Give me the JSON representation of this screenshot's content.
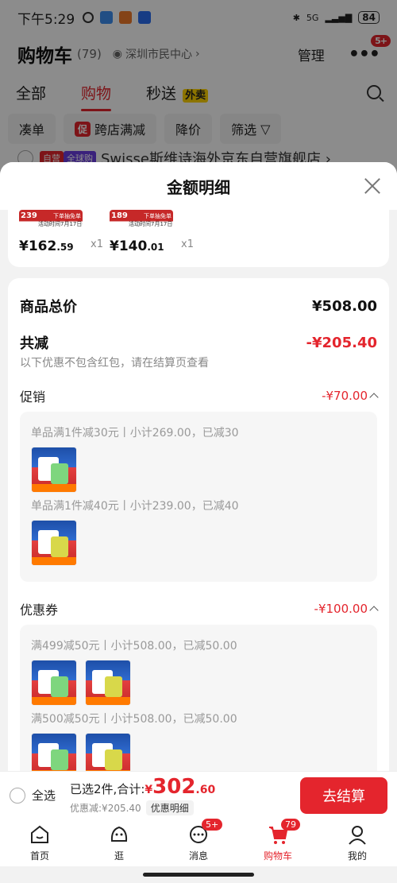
{
  "status": {
    "time": "下午5:29",
    "network": "5G",
    "battery": "84"
  },
  "header": {
    "title": "购物车",
    "count": "(79)",
    "location": "深圳市民中心",
    "manage": "管理",
    "more_badge": "5+"
  },
  "tabs": [
    {
      "label": "全部"
    },
    {
      "label": "购物"
    },
    {
      "label": "秒送"
    }
  ],
  "tab_flash_tag": "外卖",
  "chips": [
    {
      "label": "凑单"
    },
    {
      "label": "跨店满减"
    },
    {
      "label": "降价"
    },
    {
      "label": "筛选"
    }
  ],
  "chip_promo_tag": "促",
  "store": {
    "tag1": "自营",
    "tag2": "全球购",
    "name": "Swisse斯维诗海外京东自营旗舰店 ›"
  },
  "sheet": {
    "title": "金额明细",
    "products": [
      {
        "price_int": "¥162",
        "price_dec": ".59",
        "qty": "x1",
        "banner_price": "239",
        "banner_date": "活动时间7月17日-18日",
        "banner_tag": "下单抽免单"
      },
      {
        "price_int": "¥140",
        "price_dec": ".01",
        "qty": "x1",
        "banner_price": "189",
        "banner_date": "活动时间7月17日-18日",
        "banner_tag": "下单抽免单"
      }
    ],
    "total_label": "商品总价",
    "total_value": "¥508.00",
    "discount_label": "共减",
    "discount_value": "-¥205.40",
    "discount_note": "以下优惠不包含红包，请在结算页查看",
    "promo_label": "促销",
    "promo_value": "-¥70.00",
    "promo_rules": [
      "单品满1件减30元丨小计269.00，已减30",
      "单品满1件减40元丨小计239.00，已减40"
    ],
    "coupon_label": "优惠券",
    "coupon_value": "-¥100.00",
    "coupon_rules": [
      "满499减50元丨小计508.00，已减50.00",
      "满500减50元丨小计508.00，已减50.00"
    ]
  },
  "bottom": {
    "select_all": "全选",
    "selected": "已选2件,合计:",
    "currency": "¥",
    "total_int": "302",
    "total_dec": ".60",
    "saved": "优惠减:¥205.40",
    "detail_btn": "优惠明细",
    "checkout": "去结算"
  },
  "nav": [
    {
      "label": "首页"
    },
    {
      "label": "逛"
    },
    {
      "label": "消息",
      "badge": "5+"
    },
    {
      "label": "购物车",
      "badge": "79"
    },
    {
      "label": "我的"
    }
  ]
}
